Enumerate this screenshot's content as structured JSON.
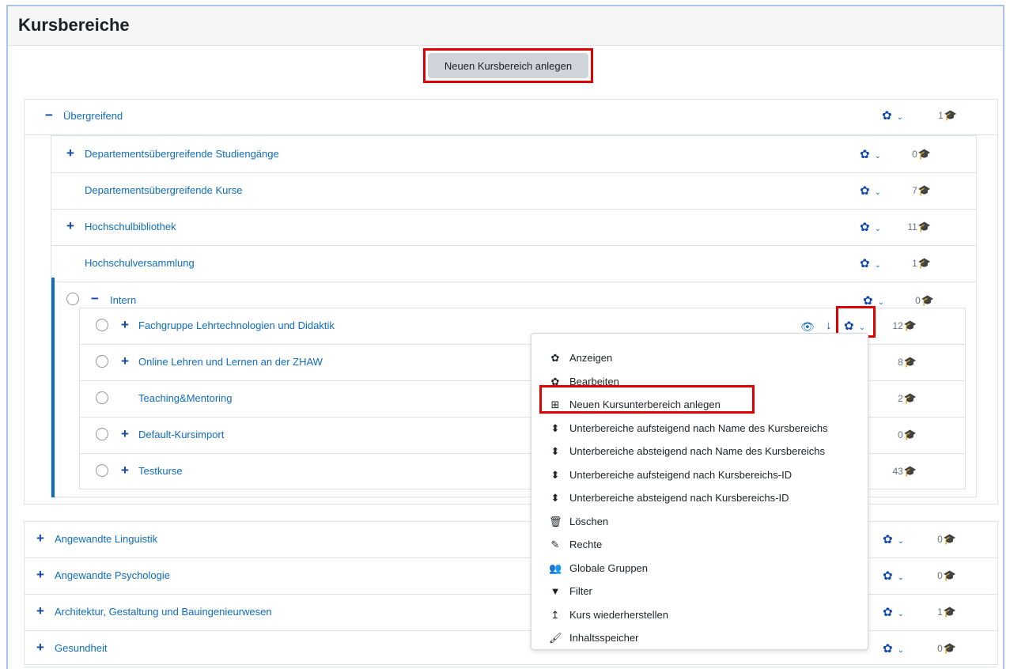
{
  "header": {
    "title": "Kursbereiche"
  },
  "create_button": "Neuen Kursbereich anlegen",
  "top_category": {
    "label": "Übergreifend",
    "count": "1"
  },
  "subcategories": [
    {
      "label": "Departementsübergreifende Studiengänge",
      "count": "0",
      "expandable": true
    },
    {
      "label": "Departementsübergreifende Kurse",
      "count": "7",
      "expandable": false
    },
    {
      "label": "Hochschulbibliothek",
      "count": "11",
      "expandable": true
    },
    {
      "label": "Hochschulversammlung",
      "count": "1",
      "expandable": false
    }
  ],
  "intern": {
    "label": "Intern",
    "count": "0"
  },
  "intern_children": [
    {
      "label": "Fachgruppe Lehrtechnologien und Didaktik",
      "count": "12",
      "expandable": true
    },
    {
      "label": "Online Lehren und Lernen an der ZHAW",
      "count": "8",
      "expandable": true
    },
    {
      "label": "Teaching&Mentoring",
      "count": "2",
      "expandable": false
    },
    {
      "label": "Default-Kursimport",
      "count": "0",
      "expandable": true
    },
    {
      "label": "Testkurse",
      "count": "43",
      "expandable": true
    }
  ],
  "top_level": [
    {
      "label": "Angewandte Linguistik",
      "count": "0"
    },
    {
      "label": "Angewandte Psychologie",
      "count": "0"
    },
    {
      "label": "Architektur, Gestaltung und Bauingenieurwesen",
      "count": "1"
    },
    {
      "label": "Gesundheit",
      "count": "0"
    }
  ],
  "menu": [
    {
      "label": "Anzeigen",
      "icon": "gear-icon"
    },
    {
      "label": "Bearbeiten",
      "icon": "gear-icon"
    },
    {
      "label": "Neuen Kursunterbereich anlegen",
      "icon": "plus-square-icon"
    },
    {
      "label": "Unterbereiche aufsteigend nach Name des Kursbereichs",
      "icon": "sort-icon"
    },
    {
      "label": "Unterbereiche absteigend nach Name des Kursbereichs",
      "icon": "sort-icon"
    },
    {
      "label": "Unterbereiche aufsteigend nach Kursbereichs-ID",
      "icon": "sort-icon"
    },
    {
      "label": "Unterbereiche absteigend nach Kursbereichs-ID",
      "icon": "sort-icon"
    },
    {
      "label": "Löschen",
      "icon": "trash-icon"
    },
    {
      "label": "Rechte",
      "icon": "pencil-square-icon"
    },
    {
      "label": "Globale Gruppen",
      "icon": "users-icon"
    },
    {
      "label": "Filter",
      "icon": "filter-icon"
    },
    {
      "label": "Kurs wiederherstellen",
      "icon": "level-up-icon"
    },
    {
      "label": "Inhaltsspeicher",
      "icon": "paint-brush-icon"
    }
  ],
  "icons": {
    "gear-icon": "✿",
    "plus-square-icon": "⊞",
    "sort-icon": "⬍",
    "trash-icon": "🗑",
    "pencil-square-icon": "✎",
    "users-icon": "👥",
    "filter-icon": "▼",
    "level-up-icon": "↥",
    "paint-brush-icon": "🖌"
  },
  "colors": {
    "link": "#0f6cbf",
    "highlight": "#e00000",
    "accent_bar": "#0f6cbf"
  }
}
